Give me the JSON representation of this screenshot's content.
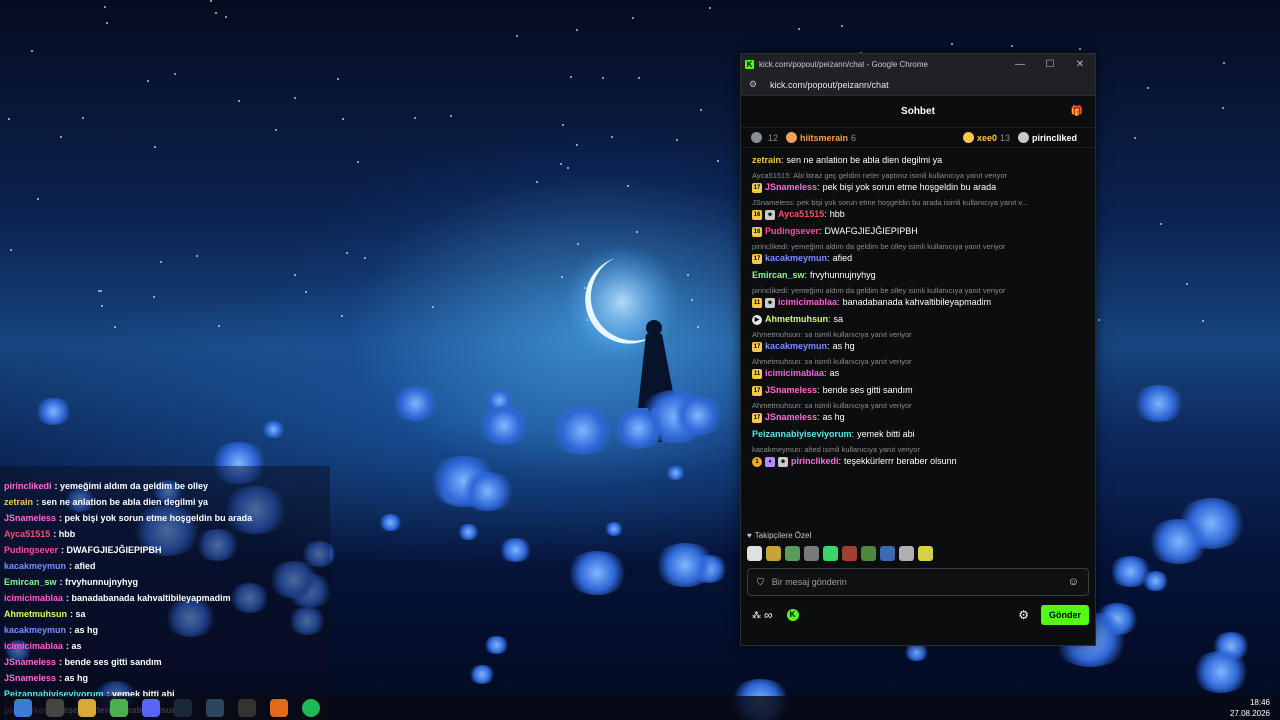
{
  "chrome": {
    "title": "kick.com/popout/peizann/chat - Google Chrome",
    "url": "kick.com/popout/peizann/chat"
  },
  "chat": {
    "header_title": "Sohbet",
    "leaderboard": [
      {
        "name": "",
        "count": "12",
        "name_color": "#8a8d91"
      },
      {
        "name": "hiitsmerain",
        "count": "6",
        "name_color": "#f0a05c"
      },
      {
        "name": "xee0",
        "count": "13",
        "name_color": "#f5c84c"
      },
      {
        "name": "pirincliked",
        "count": "",
        "name_color": "#ffffff"
      }
    ],
    "messages": [
      {
        "reply": "",
        "user": "zetrain",
        "color": "#f5c84c",
        "badges": [],
        "text": "sen ne anlation be abla dien degilmi ya"
      },
      {
        "reply": "Ayca51515: Abi biraz geç geldim neler yaptınız isimli kullanıcıya yanıt veriyor",
        "user": "JSnameless",
        "color": "#ff6ad5",
        "badges": [
          "17"
        ],
        "text": "pek bişi yok sorun etme hoşgeldin bu arada"
      },
      {
        "reply": "JSnameless: pek bişi yok sorun etme hoşgeldin bu arada isimli kullanıcıya yanıt v...",
        "user": "Ayca51515",
        "color": "#ff4d6d",
        "badges": [
          "16",
          "og"
        ],
        "text": "hbb"
      },
      {
        "reply": "",
        "user": "Pudingsever",
        "color": "#ff4d9a",
        "badges": [
          "16"
        ],
        "text": "DWAFGJIEJĞIEPIPBH"
      },
      {
        "reply": "pirinclikedi: yemeğimi aldım da geldim be olley isimli kullanıcıya yanıt veriyor",
        "user": "kacakmeymun",
        "color": "#7a8dff",
        "badges": [
          "17"
        ],
        "text": "afied"
      },
      {
        "reply": "",
        "user": "Emircan_sw",
        "color": "#7dff8a",
        "badges": [],
        "text": "frvyhunnujnyhyg"
      },
      {
        "reply": "pirinclikedi: yemeğimi aldım da geldim be olley isimli kullanıcıya yanıt veriyor",
        "user": "icimicimablaa",
        "color": "#ff5fd2",
        "badges": [
          "11",
          "og"
        ],
        "text": "banadabanada kahvaltibileyapmadim"
      },
      {
        "reply": "",
        "user": "Ahmetmuhsun",
        "color": "#d2ff5c",
        "badges": [
          "play"
        ],
        "text": "sa"
      },
      {
        "reply": "Ahmetmuhsun: sa isimli kullanıcıya yanıt veriyor",
        "user": "kacakmeymun",
        "color": "#7a8dff",
        "badges": [
          "17"
        ],
        "text": "as hg"
      },
      {
        "reply": "Ahmetmuhsun: sa isimli kullanıcıya yanıt veriyor",
        "user": "icimicimablaa",
        "color": "#ff5fd2",
        "badges": [
          "11"
        ],
        "text": "as"
      },
      {
        "reply": "",
        "user": "JSnameless",
        "color": "#ff6ad5",
        "badges": [
          "17"
        ],
        "text": "bende ses gitti sandım"
      },
      {
        "reply": "Ahmetmuhsun: sa isimli kullanıcıya yanıt veriyor",
        "user": "JSnameless",
        "color": "#ff6ad5",
        "badges": [
          "17"
        ],
        "text": "as hg"
      },
      {
        "reply": "",
        "user": "Peizannabiyiseviyorum",
        "color": "#5ce6e6",
        "badges": [],
        "text": "yemek bitti abi"
      },
      {
        "reply": "kacakmeymun: afied isimli kullanıcıya yanıt veriyor",
        "user": "pirinclikedi",
        "color": "#ff6ad5",
        "badges": [
          "1",
          "gift",
          "og"
        ],
        "text": "teşekkürlerrr beraber olsunn"
      }
    ],
    "followers_label": "Takipçilere Özel",
    "input_placeholder": "Bir mesaj gönderin",
    "infinity_label": "∞",
    "send_label": "Gönder"
  },
  "overlay": {
    "lines": [
      {
        "user": "",
        "color": "#ffffff",
        "text": ""
      },
      {
        "user": "pirinclikedi",
        "color": "#ff6ad5",
        "text": ": yemeğimi aldım da geldim be olley"
      },
      {
        "user": "zetrain",
        "color": "#f5c84c",
        "text": ": sen ne anlation be abla dien degilmi ya"
      },
      {
        "user": "JSnameless",
        "color": "#ff6ad5",
        "text": ": pek bişi yok sorun etme hoşgeldin bu arada"
      },
      {
        "user": "Ayca51515",
        "color": "#ff4d6d",
        "text": ": hbb"
      },
      {
        "user": "Pudingsever",
        "color": "#ff4d9a",
        "text": ": DWAFGJIEJĞIEPIPBH"
      },
      {
        "user": "kacakmeymun",
        "color": "#7a8dff",
        "text": ": afied"
      },
      {
        "user": "Emircan_sw",
        "color": "#7dff8a",
        "text": ": frvyhunnujnyhyg"
      },
      {
        "user": "icimicimablaa",
        "color": "#ff5fd2",
        "text": ": banadabanada kahvaltibileyapmadim"
      },
      {
        "user": "Ahmetmuhsun",
        "color": "#d2ff5c",
        "text": ": sa"
      },
      {
        "user": "kacakmeymun",
        "color": "#7a8dff",
        "text": ": as hg"
      },
      {
        "user": "icimicimablaa",
        "color": "#ff5fd2",
        "text": ": as"
      },
      {
        "user": "JSnameless",
        "color": "#ff6ad5",
        "text": ": bende ses gitti sandım"
      },
      {
        "user": "JSnameless",
        "color": "#ff6ad5",
        "text": ": as hg"
      },
      {
        "user": "Peizannabiyiseviyorum",
        "color": "#5ce6e6",
        "text": ": yemek bitti abi"
      },
      {
        "user": "pirinclikedi",
        "color": "#ff6ad5",
        "text": ": teşekkürlerrr beraber olsunn"
      }
    ]
  },
  "taskbar": {
    "apps": [
      "start",
      "search",
      "files",
      "chrome",
      "discord",
      "steam",
      "steam-2",
      "obs",
      "vlc",
      "spotify"
    ],
    "time": "18:46",
    "date": "27.08.2026"
  },
  "colors": {
    "kick_green": "#53fc18",
    "window_bg": "#0b0d0e"
  }
}
